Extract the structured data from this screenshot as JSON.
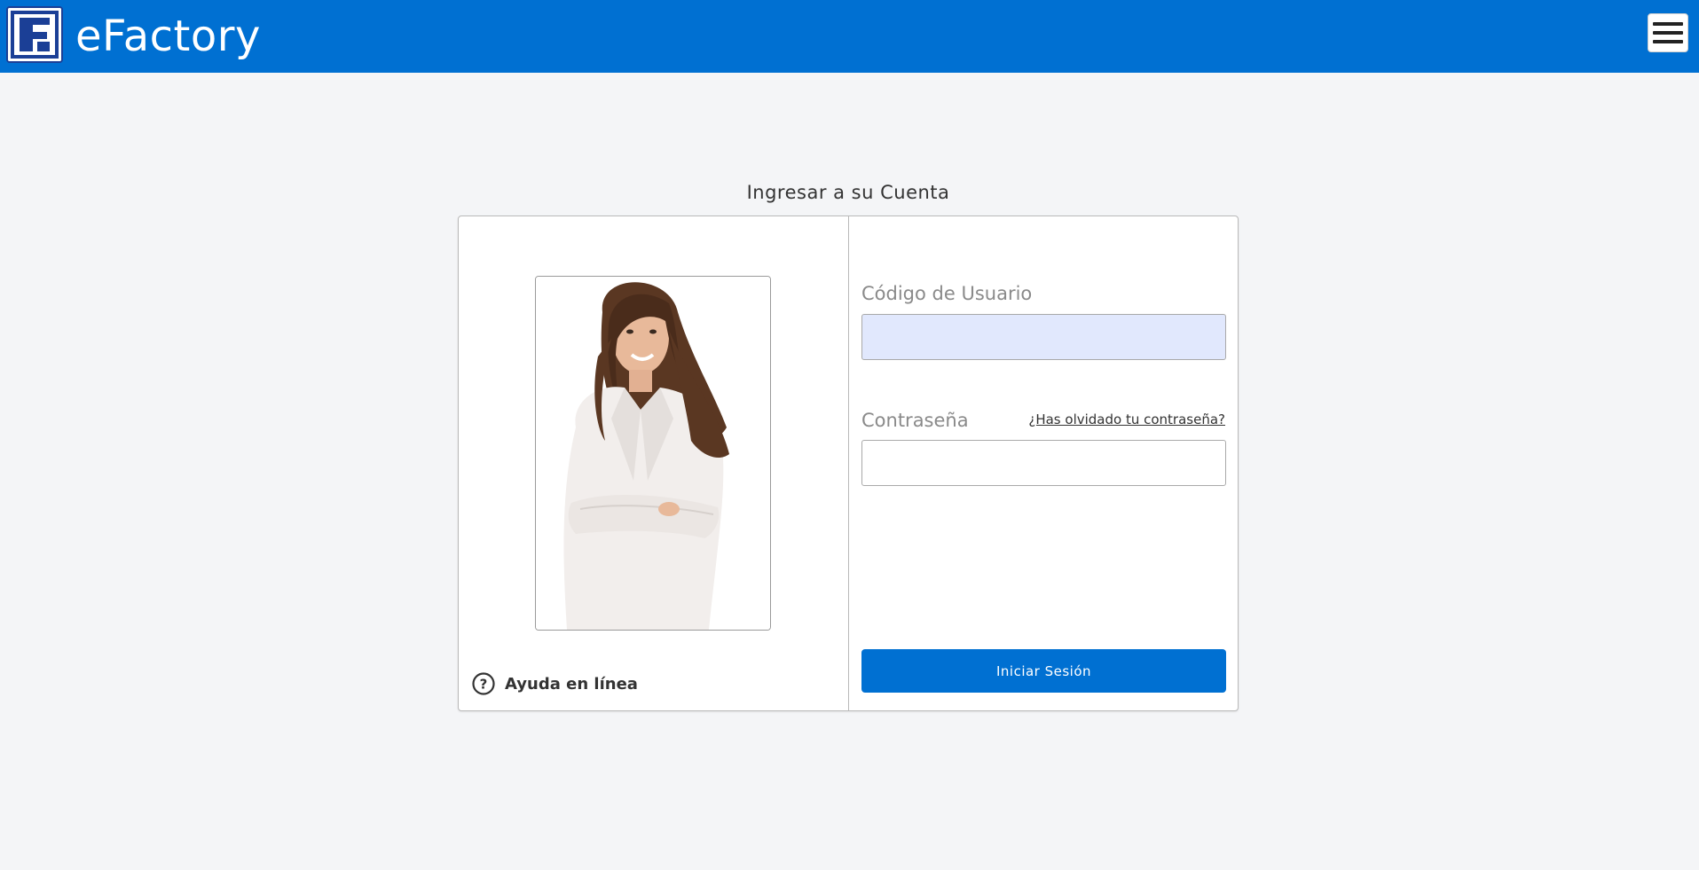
{
  "header": {
    "app_title": "eFactory",
    "logo_icon": "efactory-logo-icon",
    "menu_icon": "hamburger-menu-icon",
    "background_color": "#0070d2"
  },
  "login": {
    "heading": "Ingresar a su Cuenta",
    "username_label": "Código de Usuario",
    "username_value": "",
    "password_label": "Contraseña",
    "password_value": "",
    "forgot_password_link": "¿Has olvidado tu contraseña?",
    "submit_label": "Iniciar Sesión",
    "help_label": "Ayuda en línea",
    "help_icon": "question-circle-icon",
    "username_field_color": "#e1e8fd",
    "button_color": "#0070d2"
  }
}
